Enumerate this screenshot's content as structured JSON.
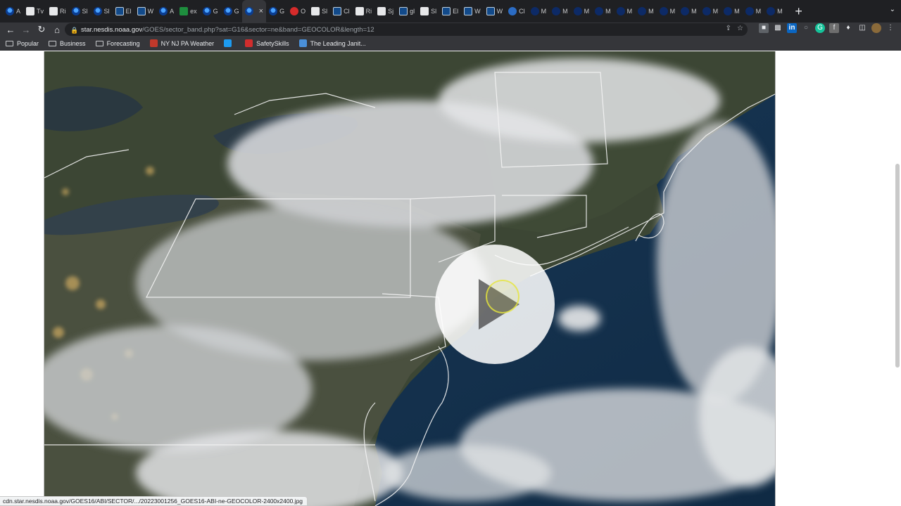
{
  "tabs": [
    {
      "label": "A",
      "fav": "noaa"
    },
    {
      "label": "Tv",
      "fav": "white"
    },
    {
      "label": "Ri",
      "fav": "white"
    },
    {
      "label": "Sl",
      "fav": "noaa"
    },
    {
      "label": "Sl",
      "fav": "noaa"
    },
    {
      "label": "El",
      "fav": "sat"
    },
    {
      "label": "W",
      "fav": "sat"
    },
    {
      "label": "A",
      "fav": "noaa"
    },
    {
      "label": "ex",
      "fav": "green"
    },
    {
      "label": "G",
      "fav": "noaa"
    },
    {
      "label": "G",
      "fav": "noaa"
    },
    {
      "label": "",
      "fav": "noaa",
      "active": true
    },
    {
      "label": "G",
      "fav": "noaa"
    },
    {
      "label": "O",
      "fav": "red"
    },
    {
      "label": "Sl",
      "fav": "white"
    },
    {
      "label": "Cl",
      "fav": "sat"
    },
    {
      "label": "Ri",
      "fav": "white"
    },
    {
      "label": "Sj",
      "fav": "white"
    },
    {
      "label": "gl",
      "fav": "sat"
    },
    {
      "label": "Sl",
      "fav": "white"
    },
    {
      "label": "El",
      "fav": "sat"
    },
    {
      "label": "W",
      "fav": "sat"
    },
    {
      "label": "W",
      "fav": "sat"
    },
    {
      "label": "Cl",
      "fav": "blue"
    },
    {
      "label": "M",
      "fav": "dark"
    },
    {
      "label": "M",
      "fav": "dark"
    },
    {
      "label": "M",
      "fav": "dark"
    },
    {
      "label": "M",
      "fav": "dark"
    },
    {
      "label": "M",
      "fav": "dark"
    },
    {
      "label": "M",
      "fav": "dark"
    },
    {
      "label": "M",
      "fav": "dark"
    },
    {
      "label": "M",
      "fav": "dark"
    },
    {
      "label": "M",
      "fav": "dark"
    },
    {
      "label": "M",
      "fav": "dark"
    },
    {
      "label": "M",
      "fav": "dark"
    },
    {
      "label": "M",
      "fav": "dark"
    }
  ],
  "address": {
    "host": "star.nesdis.noaa.gov",
    "path": "/GOES/sector_band.php?sat=G16&sector=ne&band=GEOCOLOR&length=12"
  },
  "bookmarks": [
    {
      "label": "Popular",
      "type": "folder"
    },
    {
      "label": "Business",
      "type": "folder"
    },
    {
      "label": "Forecasting",
      "type": "folder"
    },
    {
      "label": "NY NJ PA Weather",
      "type": "site",
      "color": "#c0392b"
    },
    {
      "label": "",
      "type": "site",
      "color": "#1d9bf0"
    },
    {
      "label": "SafetySkills",
      "type": "site",
      "color": "#d12d2d"
    },
    {
      "label": "The Leading Janit...",
      "type": "site",
      "color": "#4a90d9"
    }
  ],
  "status_url": "cdn.star.nesdis.noaa.gov/GOES16/ABI/SECTOR/.../20223001256_GOES16-ABI-ne-GEOCOLOR-2400x2400.jpg",
  "icons": {
    "back": "back-arrow-icon",
    "forward": "forward-arrow-icon",
    "reload": "reload-icon",
    "home": "home-icon",
    "play": "play-icon"
  }
}
